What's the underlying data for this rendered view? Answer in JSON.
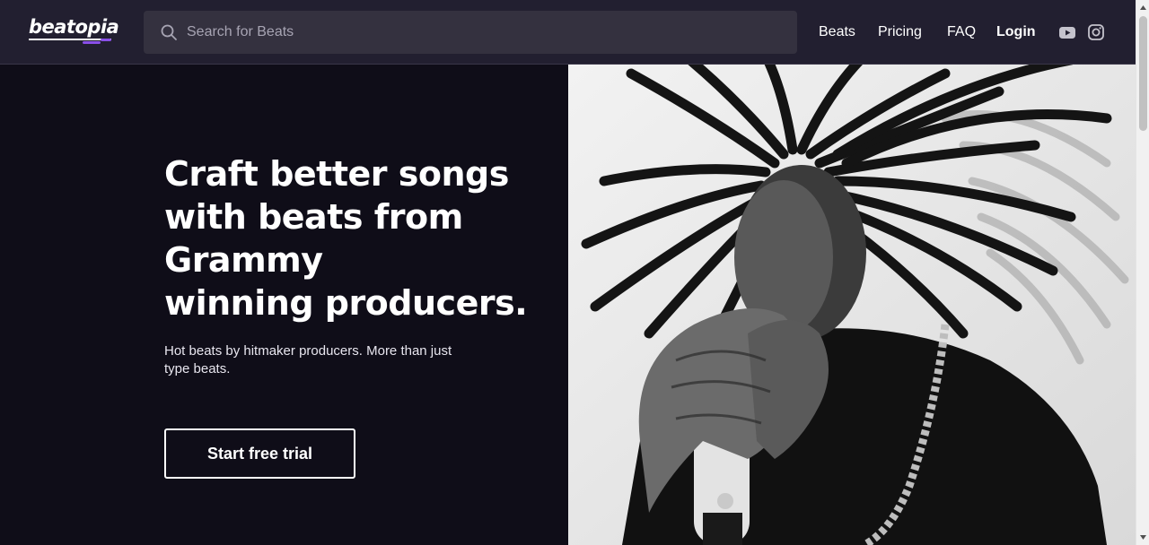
{
  "brand": {
    "name": "beatopia",
    "accent_color": "#8a4fe8"
  },
  "search": {
    "placeholder": "Search for Beats",
    "value": ""
  },
  "nav": {
    "links": [
      {
        "label": "Beats"
      },
      {
        "label": "Pricing"
      },
      {
        "label": "FAQ"
      },
      {
        "label": "Login"
      }
    ],
    "social": [
      "youtube-icon",
      "instagram-icon"
    ]
  },
  "hero": {
    "headline_lines": [
      "Craft better songs",
      "with beats from",
      "Grammy",
      "winning producers."
    ],
    "subtext": "Hot beats by hitmaker producers. More than just type beats.",
    "cta_label": "Start free trial"
  },
  "colors": {
    "header_bg": "#221f30",
    "hero_bg": "#0f0d18",
    "search_bg": "#34313f"
  }
}
